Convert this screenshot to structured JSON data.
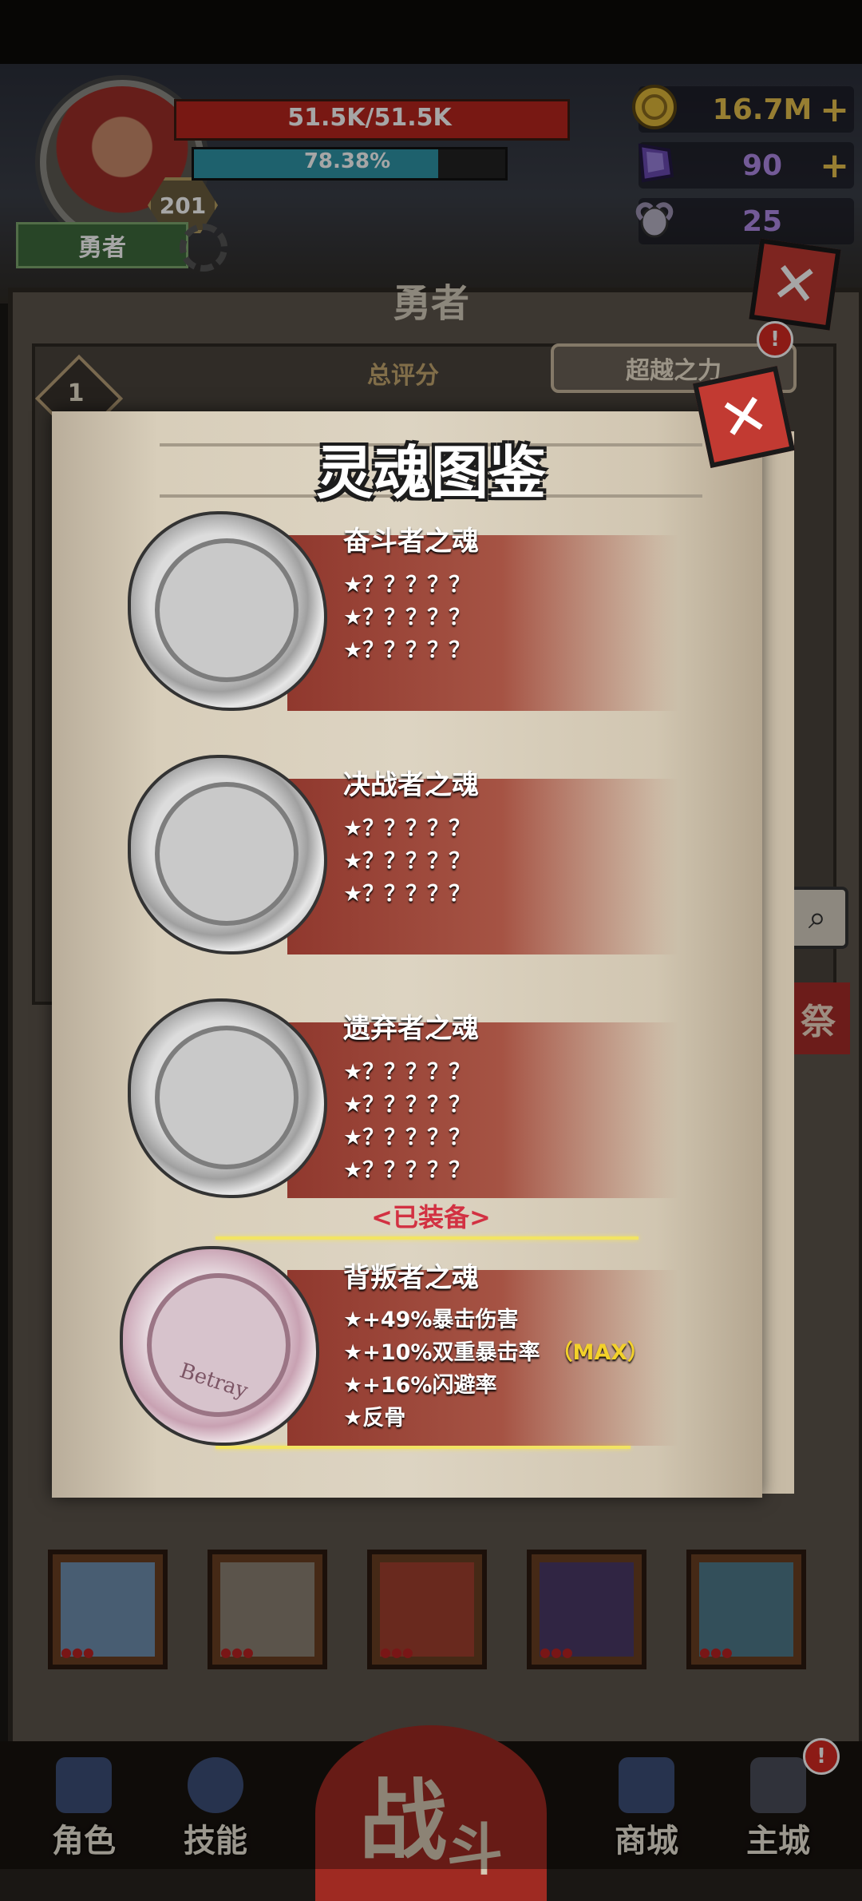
{
  "hud": {
    "hp_text": "51.5K/51.5K",
    "xp_text": "78.38%",
    "xp_fraction": 0.7838,
    "level": "201",
    "hero_tag": "勇者"
  },
  "currencies": [
    {
      "icon": "gold-coin-icon",
      "value": "16.7M",
      "plus": "+"
    },
    {
      "icon": "purple-gem-icon",
      "value": "90",
      "plus": "+"
    },
    {
      "icon": "ram-skull-icon",
      "value": "25"
    }
  ],
  "panel": {
    "title": "勇者",
    "rank_number": "1",
    "rank_label": "总评分",
    "transcend_button": "超越之力",
    "badge": "!",
    "side_button": "祭"
  },
  "modal": {
    "title": "灵魂图鉴",
    "equipped_label": "<已装备>",
    "souls": [
      {
        "name": "奋斗者之魂",
        "stats": [
          "★？？？？？",
          "★？？？？？",
          "★？？？？？"
        ],
        "equipped": false
      },
      {
        "name": "决战者之魂",
        "stats": [
          "★？？？？？",
          "★？？？？？",
          "★？？？？？"
        ],
        "equipped": false
      },
      {
        "name": "遗弃者之魂",
        "stats": [
          "★？？？？？",
          "★？？？？？",
          "★？？？？？",
          "★？？？？？"
        ],
        "equipped": false
      },
      {
        "name": "背叛者之魂",
        "stats": [
          "★+49%暴击伤害",
          "★+10%双重暴击率",
          "★+16%闪避率",
          "★反骨"
        ],
        "max_tag": "（MAX）",
        "equipped": true,
        "seal_text": "Betray"
      }
    ]
  },
  "nav": {
    "items": [
      "角色",
      "技能",
      "商城",
      "主城"
    ],
    "battle_top": "战",
    "battle_bottom": "斗",
    "badge": "!"
  },
  "colors": {
    "hp": "#b8261e",
    "xp": "#2f96a8",
    "accent_red": "#c23a32",
    "max_yellow": "#f3d12a",
    "equipped_label": "#d23142"
  }
}
